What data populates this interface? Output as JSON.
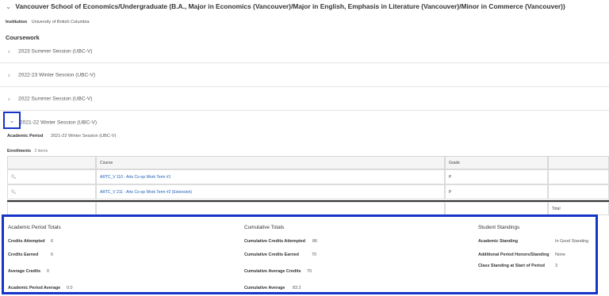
{
  "program": {
    "title": "Vancouver School of Economics/Undergraduate (B.A., Major in Economics (Vancouver)/Major in English, Emphasis in Literature (Vancouver)/Minor in Commerce (Vancouver))"
  },
  "institution": {
    "label": "Institution",
    "value": "University of British Columbia"
  },
  "coursework_label": "Coursework",
  "sessions": [
    {
      "label": "2023 Summer Session (UBC-V)",
      "expanded": false
    },
    {
      "label": "2022-23 Winter Session (UBC-V)",
      "expanded": false
    },
    {
      "label": "2022 Summer Session (UBC-V)",
      "expanded": false
    },
    {
      "label": "2021-22 Winter Session (UBC-V)",
      "expanded": true
    }
  ],
  "academic_period": {
    "label": "Academic Period",
    "value": "2021-22 Winter Session (UBC-V)"
  },
  "enrollments": {
    "label": "Enrollments",
    "count": "2 items",
    "columns": [
      "Course",
      "Grade"
    ],
    "rows": [
      {
        "course": "ARTC_V 110 - Arts Co-op Work Term #1",
        "grade": "P"
      },
      {
        "course": "ARTC_V 211 - Arts Co-op Work Term #2 (Extension)",
        "grade": "P"
      }
    ],
    "total_label": "Total"
  },
  "period_totals": {
    "title": "Academic Period Totals",
    "credits_attempted_label": "Credits Attempted",
    "credits_attempted": "6",
    "credits_earned_label": "Credits Earned",
    "credits_earned": "6",
    "average_credits_label": "Average Credits",
    "average_credits": "0",
    "period_average_label": "Academic Period Average",
    "period_average": "0.0"
  },
  "cumulative_totals": {
    "title": "Cumulative Totals",
    "credits_attempted_label": "Cumulative Credits Attempted",
    "credits_attempted": "86",
    "credits_earned_label": "Cumulative Credits Earned",
    "credits_earned": "70",
    "average_credits_label": "Cumulative Average Credits",
    "average_credits": "70",
    "average_label": "Cumulative Average",
    "average": "83.2"
  },
  "student_standings": {
    "title": "Student Standings",
    "academic_standing_label": "Academic Standing",
    "academic_standing": "In Good Standing",
    "honors_label": "Additional Period Honors/Standing",
    "honors": "None",
    "class_standing_label": "Class Standing at Start of Period",
    "class_standing": "3"
  },
  "icons": {
    "collapse": "chevron-down-icon",
    "expand": "chevron-right-icon",
    "view": "search-icon"
  },
  "colors": {
    "focus_outline": "#1634c8",
    "link": "#1f5fb5"
  }
}
